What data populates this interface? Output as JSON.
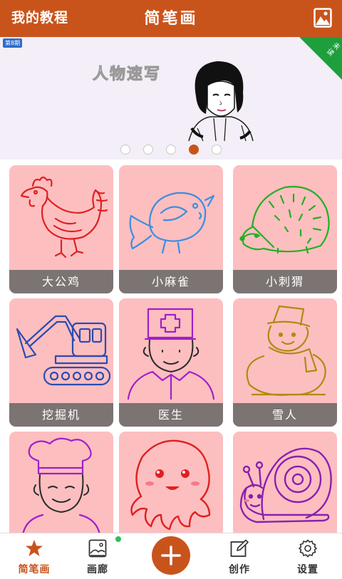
{
  "header": {
    "my_tutorials": "我的教程",
    "title": "简笔画",
    "gallery_icon": "image-gallery-icon",
    "color": "#c9541b"
  },
  "banner": {
    "issue_badge": "第8期",
    "title": "人物速写",
    "unread_badge": "未读",
    "pager": {
      "count": 5,
      "active_index": 3
    }
  },
  "grid": {
    "items": [
      {
        "label": "大公鸡",
        "icon": "rooster-drawing"
      },
      {
        "label": "小麻雀",
        "icon": "sparrow-drawing"
      },
      {
        "label": "小刺猬",
        "icon": "hedgehog-drawing"
      },
      {
        "label": "挖掘机",
        "icon": "excavator-drawing"
      },
      {
        "label": "医生",
        "icon": "doctor-drawing"
      },
      {
        "label": "雪人",
        "icon": "snowman-drawing"
      },
      {
        "label": "",
        "icon": "chef-drawing"
      },
      {
        "label": "",
        "icon": "octopus-drawing"
      },
      {
        "label": "",
        "icon": "snail-drawing"
      }
    ]
  },
  "bottom_nav": {
    "items": [
      {
        "label": "简笔画",
        "icon": "star-icon",
        "active": true
      },
      {
        "label": "画廊",
        "icon": "gallery-icon",
        "active": false
      },
      {
        "label": "",
        "icon": "plus-icon",
        "active": false
      },
      {
        "label": "创作",
        "icon": "edit-icon",
        "active": false
      },
      {
        "label": "设置",
        "icon": "gear-icon",
        "active": false
      }
    ],
    "accent": "#c9541b",
    "notification_color": "#2fbf5a"
  }
}
